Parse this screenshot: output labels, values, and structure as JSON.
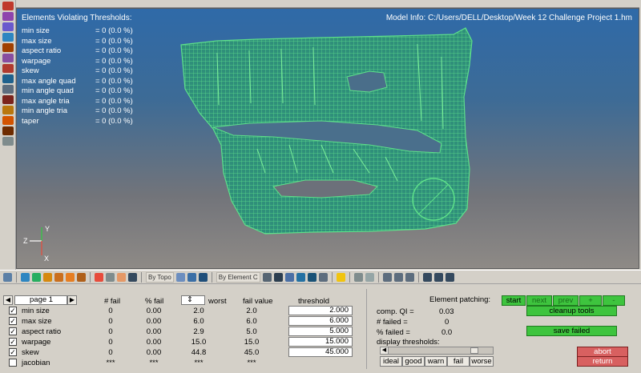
{
  "viewport": {
    "violations_title": "Elements Violating Thresholds:",
    "violations": [
      {
        "name": "min size",
        "value": "= 0 (0.0 %)"
      },
      {
        "name": "max size",
        "value": "= 0 (0.0 %)"
      },
      {
        "name": "aspect ratio",
        "value": "= 0 (0.0 %)"
      },
      {
        "name": "warpage",
        "value": "= 0 (0.0 %)"
      },
      {
        "name": "skew",
        "value": "= 0 (0.0 %)"
      },
      {
        "name": "max angle quad",
        "value": "= 0 (0.0 %)"
      },
      {
        "name": "min angle quad",
        "value": "= 0 (0.0 %)"
      },
      {
        "name": "max angle tria",
        "value": "= 0 (0.0 %)"
      },
      {
        "name": "min angle tria",
        "value": "= 0 (0.0 %)"
      },
      {
        "name": "taper",
        "value": "= 0 (0.0 %)"
      }
    ],
    "model_info": "Model Info: C:/Users/DELL/Desktop/Week 12 Challenge Project 1.hm",
    "triad": {
      "z": "Z",
      "y": "Y",
      "x": "X"
    },
    "mesh_color": "#3fbf6a"
  },
  "toolbar": {
    "by_topo": "By Topo",
    "by_element": "By Element C"
  },
  "panel": {
    "page_label": "page 1",
    "page_prev": "◀",
    "page_next": "▶",
    "columns": {
      "fail": "# fail",
      "pct_fail": "% fail",
      "sort": "⇕",
      "worst": "worst",
      "fail_value": "fail value",
      "threshold": "threshold"
    },
    "rows": [
      {
        "checked": true,
        "name": "min size",
        "fail": "0",
        "pct": "0.00",
        "worst": "2.0",
        "failval": "2.0",
        "threshold": "2.000"
      },
      {
        "checked": true,
        "name": "max size",
        "fail": "0",
        "pct": "0.00",
        "worst": "6.0",
        "failval": "6.0",
        "threshold": "6.000"
      },
      {
        "checked": true,
        "name": "aspect ratio",
        "fail": "0",
        "pct": "0.00",
        "worst": "2.9",
        "failval": "5.0",
        "threshold": "5.000"
      },
      {
        "checked": true,
        "name": "warpage",
        "fail": "0",
        "pct": "0.00",
        "worst": "15.0",
        "failval": "15.0",
        "threshold": "15.000"
      },
      {
        "checked": true,
        "name": "skew",
        "fail": "0",
        "pct": "0.00",
        "worst": "44.8",
        "failval": "45.0",
        "threshold": "45.000"
      },
      {
        "checked": false,
        "name": "jacobian",
        "fail": "***",
        "pct": "***",
        "worst": "***",
        "failval": "***",
        "threshold": ""
      }
    ],
    "stats": {
      "comp_qi_label": "comp. QI =",
      "comp_qi_value": "0.03",
      "failed_label": "# failed =",
      "failed_value": "0",
      "pct_failed_label": "% failed =",
      "pct_failed_value": "0.0"
    },
    "display_thresholds_label": "display thresholds:",
    "thresholds": [
      "ideal",
      "good",
      "warn",
      "fail",
      "worse"
    ],
    "element_patching_label": "Element patching:",
    "patch_buttons": [
      "start",
      "next",
      "prev",
      "+",
      "-"
    ],
    "cleanup_tools": "cleanup tools",
    "save_failed": "save failed",
    "abort": "abort",
    "return": "return"
  }
}
